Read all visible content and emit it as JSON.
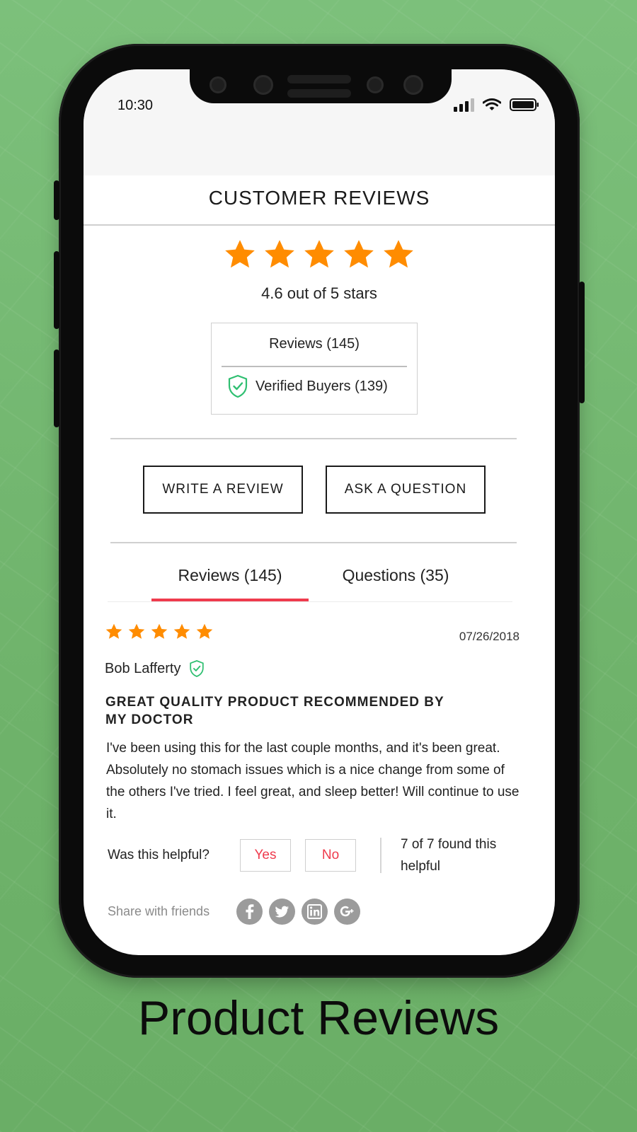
{
  "status_bar": {
    "time": "10:30"
  },
  "header": {
    "title": "CUSTOMER REVIEWS"
  },
  "rating": {
    "value": 4.6,
    "max": 5,
    "text": "4.6 out of 5 stars",
    "star_color": "#ff8c00"
  },
  "summary": {
    "reviews_label": "Reviews (145)",
    "verified_label": "Verified Buyers (139)"
  },
  "actions": {
    "write_review": "WRITE A REVIEW",
    "ask_question": "ASK A QUESTION"
  },
  "tabs": [
    {
      "label": "Reviews (145)",
      "active": true
    },
    {
      "label": "Questions (35)",
      "active": false
    }
  ],
  "review": {
    "stars": 5,
    "date": "07/26/2018",
    "author": "Bob Lafferty",
    "verified": true,
    "title_line1": "GREAT QUALITY PRODUCT RECOMMENDED BY",
    "title_line2": "MY DOCTOR",
    "body": "I've been using this for the last couple months, and it's been great. Absolutely no stomach issues which is a nice change from some of the others I've tried. I feel great, and sleep better! Will continue to use it.",
    "helpful_question": "Was this helpful?",
    "yes_label": "Yes",
    "no_label": "No",
    "helpful_count_line1": "7 of 7 found this",
    "helpful_count_line2": "helpful",
    "share_label": "Share with friends",
    "share_icons": [
      "facebook-icon",
      "twitter-icon",
      "linkedin-icon",
      "google-plus-icon"
    ]
  },
  "caption": "Product Reviews",
  "colors": {
    "accent": "#ef3b4d",
    "verified": "#2fbf71",
    "background": "#70b76c"
  }
}
